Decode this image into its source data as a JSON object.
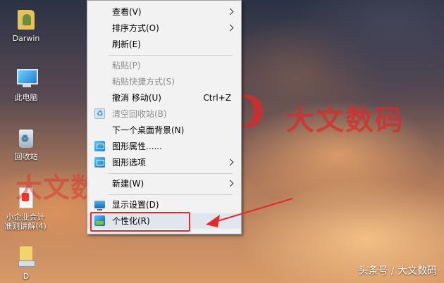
{
  "desktop": {
    "icons": [
      {
        "label": "Darwin",
        "icon": "user-folder-icon"
      },
      {
        "label": "此电脑",
        "icon": "this-pc-icon"
      },
      {
        "label": "回收站",
        "icon": "recycle-bin-icon"
      },
      {
        "label_line1": "小企业会计",
        "label_line2": "准则讲解(4)",
        "icon": "document-icon"
      },
      {
        "label": "D",
        "icon": "drive-icon"
      }
    ]
  },
  "context_menu": {
    "items": [
      {
        "label": "查看(V)",
        "has_submenu": true
      },
      {
        "label": "排序方式(O)",
        "has_submenu": true
      },
      {
        "label": "刷新(E)"
      },
      {
        "label": "粘贴(P)",
        "disabled": true
      },
      {
        "label": "粘贴快捷方式(S)",
        "disabled": true
      },
      {
        "label": "撤消 移动(U)",
        "shortcut": "Ctrl+Z"
      },
      {
        "label": "清空回收站(B)",
        "disabled": true,
        "icon": "recycle-bin-icon"
      },
      {
        "label": "下一个桌面背景(N)"
      },
      {
        "label": "图形属性......",
        "icon": "graphics-icon"
      },
      {
        "label": "图形选项",
        "icon": "graphics-icon",
        "has_submenu": true
      },
      {
        "label": "新建(W)",
        "has_submenu": true
      },
      {
        "label": "显示设置(D)",
        "icon": "display-icon"
      },
      {
        "label": "个性化(R)",
        "icon": "personalize-icon",
        "highlighted": true
      }
    ]
  },
  "watermarks": {
    "big_letter": "D",
    "big_text": "大文数码",
    "small_text": "大文数码"
  },
  "attribution": "头条号 / 大文数码",
  "colors": {
    "highlight_border": "#e42a2a",
    "menu_background": "#f2f2f2",
    "watermark_red": "#de2828"
  }
}
